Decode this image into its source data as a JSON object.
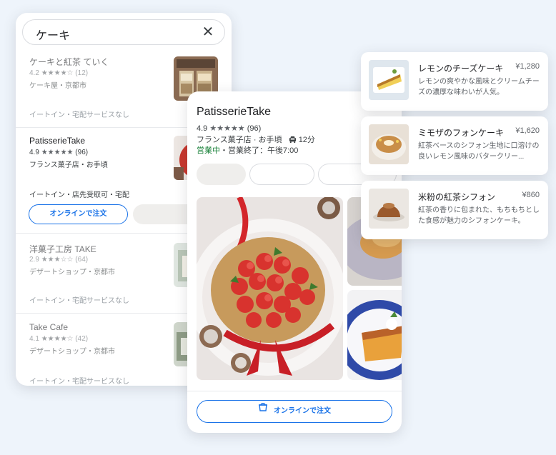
{
  "search": {
    "query": "ケーキ",
    "clear_icon": "close-icon"
  },
  "results": [
    {
      "name": "ケーキと紅茶 ていく",
      "rating": "4.2",
      "stars": "★★★★☆",
      "count": "(12)",
      "category": "ケーキ屋・京都市",
      "services": "イートイン・宅配サービスなし"
    },
    {
      "name": "PatisserieTake",
      "rating": "4.9",
      "stars": "★★★★★",
      "count": "(96)",
      "category": "フランス菓子店・お手頃",
      "services": "イートイン・店先受取可・宅配",
      "order_label": "オンラインで注文"
    },
    {
      "name": "洋菓子工房 TAKE",
      "rating": "2.9",
      "stars": "★★★☆☆",
      "count": "(64)",
      "category": "デザートショップ・京都市",
      "services": "イートイン・宅配サービスなし"
    },
    {
      "name": "Take Cafe",
      "rating": "4.1",
      "stars": "★★★★☆",
      "count": "(42)",
      "category": "デザートショップ・京都市",
      "services": "イートイン・宅配サービスなし"
    }
  ],
  "detail": {
    "title": "PatisserieTake",
    "rating": "4.9",
    "stars": "★★★★★",
    "count": "(96)",
    "category": "フランス菓子店 · お手頃",
    "drive_time": "12分",
    "open_status": "営業中",
    "hours": "・営業終了：午後7:00",
    "order_label": "オンラインで注文"
  },
  "menu": [
    {
      "name": "レモンのチーズケーキ",
      "price": "¥1,280",
      "description": "レモンの爽やかな風味とクリームチーズの濃厚な味わいが人気。"
    },
    {
      "name": "ミモザのフォンケーキ",
      "price": "¥1,620",
      "description": "紅茶ベースのシフォン生地に口溶けの良いレモン風味のバタークリー..."
    },
    {
      "name": "米粉の紅茶シフォン",
      "price": "¥860",
      "description": "紅茶の香りに包まれた、もちもちとした食感が魅力のシフォンケーキ。"
    }
  ],
  "colors": {
    "accent": "#1a73e8",
    "open_green": "#188038",
    "background": "#eef4fb"
  }
}
